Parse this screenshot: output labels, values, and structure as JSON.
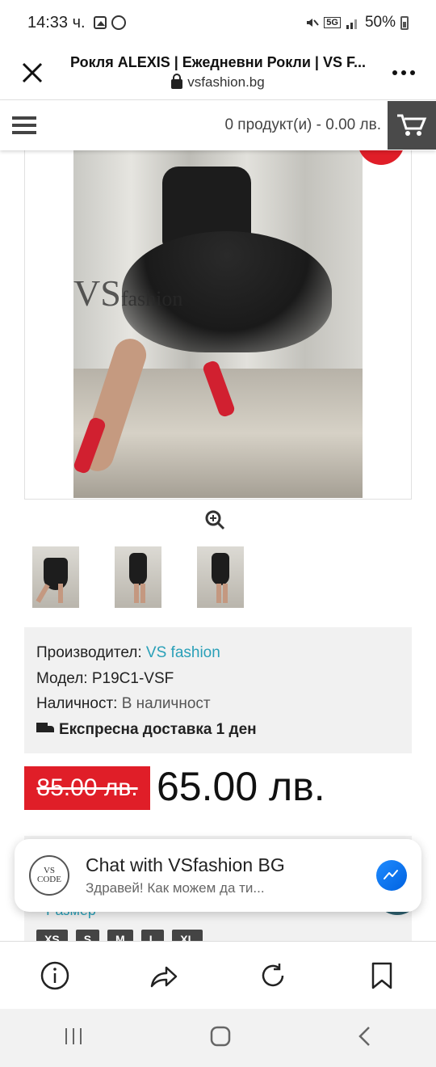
{
  "status_bar": {
    "time": "14:33 ч.",
    "network": "5G",
    "battery": "50%"
  },
  "browser": {
    "page_title": "Рокля ALEXIS | Ежедневни Рокли | VS F...",
    "domain": "vsfashion.bg"
  },
  "site_header": {
    "cart_summary": "0 продукт(и) - 0.00 лв."
  },
  "product_image": {
    "watermark_main": "VS",
    "watermark_sub": "fashion"
  },
  "info": {
    "manufacturer_label": "Производител:",
    "manufacturer_value": "VS fashion",
    "model_label": "Модел:",
    "model_value": "P19C1-VSF",
    "availability_label": "Наличност:",
    "availability_value": "В наличност",
    "delivery": "Експресна доставка 1 ден"
  },
  "price": {
    "old": "85.00 лв.",
    "new": "65.00 лв."
  },
  "options": {
    "required_mark": "*",
    "size_label": "Размер",
    "sizes": [
      "XS",
      "S",
      "M",
      "L",
      "XL"
    ]
  },
  "chat": {
    "logo_text": "VS CODE",
    "title": "Chat with VSfashion BG",
    "subtitle": "Здравей! Как можем да ти..."
  },
  "colors": {
    "accent": "#2aa0b8",
    "sale_red": "#e01e28",
    "cart_button": "#4a4a4a"
  }
}
